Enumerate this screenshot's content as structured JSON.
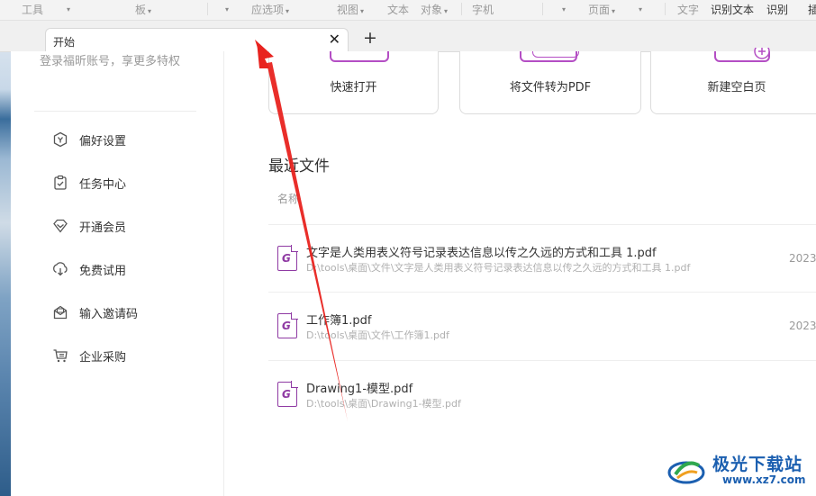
{
  "toolbar": {
    "items": [
      "工具",
      "板",
      "应选项",
      "视图",
      "文本",
      "对象",
      "字机",
      "页面",
      "文字",
      "识别文本",
      "识别",
      "插"
    ]
  },
  "tabs": {
    "active_label": "开始",
    "close_glyph": "✕",
    "add_glyph": "+"
  },
  "sidebar": {
    "login_hint": "登录福昕账号，享更多特权",
    "items": [
      {
        "label": "偏好设置",
        "icon": "preferences-icon"
      },
      {
        "label": "任务中心",
        "icon": "task-center-icon"
      },
      {
        "label": "开通会员",
        "icon": "membership-icon"
      },
      {
        "label": "免费试用",
        "icon": "free-trial-icon"
      },
      {
        "label": "输入邀请码",
        "icon": "invite-code-icon"
      },
      {
        "label": "企业采购",
        "icon": "enterprise-purchase-icon"
      }
    ]
  },
  "quick_actions": [
    {
      "label": "快速打开"
    },
    {
      "label": "将文件转为PDF"
    },
    {
      "label": "新建空白页"
    }
  ],
  "recent": {
    "title": "最近文件",
    "column_name": "名称",
    "files": [
      {
        "name": "文字是人类用表义符号记录表达信息以传之久远的方式和工具 1.pdf",
        "path": "D:\\tools\\桌面\\文件\\文字是人类用表义符号记录表达信息以传之久远的方式和工具 1.pdf",
        "date": "2023-"
      },
      {
        "name": "工作簿1.pdf",
        "path": "D:\\tools\\桌面\\文件\\工作簿1.pdf",
        "date": "2023-"
      },
      {
        "name": "Drawing1-模型.pdf",
        "path": "D:\\tools\\桌面\\Drawing1-模型.pdf",
        "date": ""
      }
    ]
  },
  "watermark": {
    "name": "极光下载站",
    "url": "www.xz7.com"
  },
  "colors": {
    "accent": "#8f3aa3",
    "arrow": "#e8231f",
    "watermark": "#1b5fb0"
  }
}
